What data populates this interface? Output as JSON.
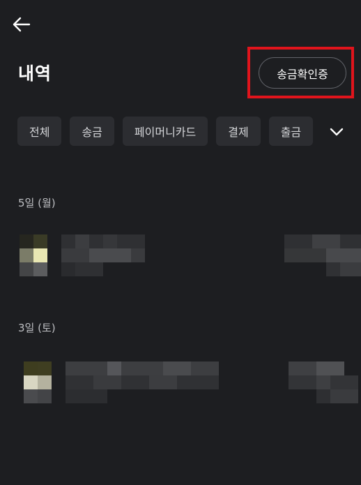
{
  "header": {
    "back_icon": "arrow-left-icon",
    "title": "내역",
    "verify_button_label": "송금확인증"
  },
  "filters": {
    "chips": [
      "전체",
      "송금",
      "페이머니카드",
      "결제",
      "출금"
    ],
    "expand_icon": "chevron-down-icon"
  },
  "history": {
    "groups": [
      {
        "date_label": "5일 (월)"
      },
      {
        "date_label": "3일 (토)"
      }
    ]
  },
  "colors": {
    "background": "#1d1e21",
    "chip_background": "#2c2d31",
    "highlight": "#e0141c"
  }
}
